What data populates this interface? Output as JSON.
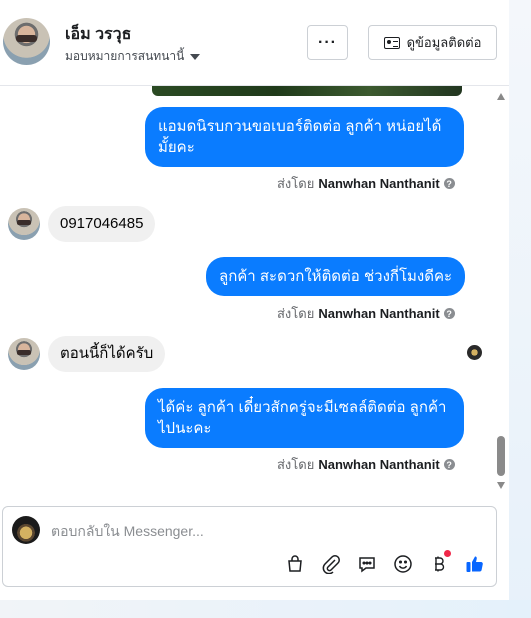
{
  "header": {
    "contact_name": "เอ็ม วรวุธ",
    "assign_label": "มอบหมายการสนทนานี้",
    "more_label": "···",
    "contact_info_label": "ดูข้อมูลติดต่อ"
  },
  "messages": [
    {
      "direction": "out",
      "text": "แอมดนิรบกวนขอเบอร์ติดต่อ ลูกค้า  หน่อยได้มั้ยคะ",
      "sent_by_prefix": "ส่งโดย",
      "sender": "Nanwhan Nanthanit"
    },
    {
      "direction": "in",
      "text": "0917046485"
    },
    {
      "direction": "out",
      "text": "ลูกค้า สะดวกให้ติดต่อ ช่วงกี่โมงดีคะ",
      "sent_by_prefix": "ส่งโดย",
      "sender": "Nanwhan Nanthanit"
    },
    {
      "direction": "in",
      "text": "ตอนนี้ก็ได้ครับ"
    },
    {
      "direction": "out",
      "text": "ได้ค่ะ  ลูกค้า เดี๋ยวสักครู่จะมีเซลล์ติดต่อ ลูกค้าไปนะคะ",
      "sent_by_prefix": "ส่งโดย",
      "sender": "Nanwhan Nanthanit"
    }
  ],
  "composer": {
    "placeholder": "ตอบกลับใน Messenger...",
    "tools": [
      "shopping-bag-icon",
      "paperclip-icon",
      "saved-reply-icon",
      "emoji-icon",
      "bitcoin-icon",
      "thumbs-up-icon"
    ]
  },
  "colors": {
    "outgoing_bubble": "#0a7cff",
    "incoming_bubble": "#f0f0f0",
    "like_icon": "#0866ff",
    "notification_dot": "#f02849"
  }
}
